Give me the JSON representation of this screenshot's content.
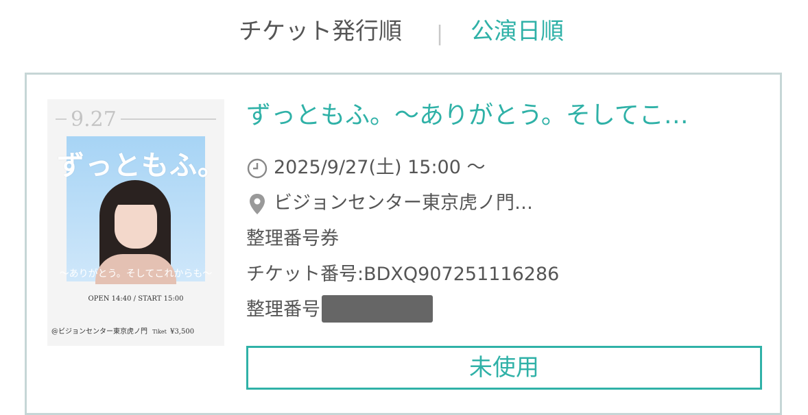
{
  "sort": {
    "issue_order": "チケット発行順",
    "separator": "|",
    "date_order": "公演日順",
    "active": "date_order",
    "active_color": "#2fb1a7",
    "inactive_color": "#555555"
  },
  "ticket": {
    "poster": {
      "date": "9.27",
      "title": "ずっともふ。",
      "subtitle": "〜ありがとう。そしてこれからも〜",
      "times": "OPEN 14:40  /  START 15:00",
      "venue": "@ビジョンセンター東京虎ノ門",
      "ticket_label": "Tiket",
      "price": "¥3,500"
    },
    "title": "ずっともふ。〜ありがとう。そしてこ…",
    "datetime": "2025/9/27(土) 15:00 〜",
    "datetime_icon": "clock-icon",
    "venue": "ビジョンセンター東京虎ノ門…",
    "venue_icon": "location-pin-icon",
    "ticket_type": "整理番号券",
    "ticket_number_label": "チケット番号:",
    "ticket_number": "BDXQ907251116286",
    "seat_number_label": "整理番号",
    "status_button": "未使用",
    "accent_color": "#2fb1a7"
  }
}
